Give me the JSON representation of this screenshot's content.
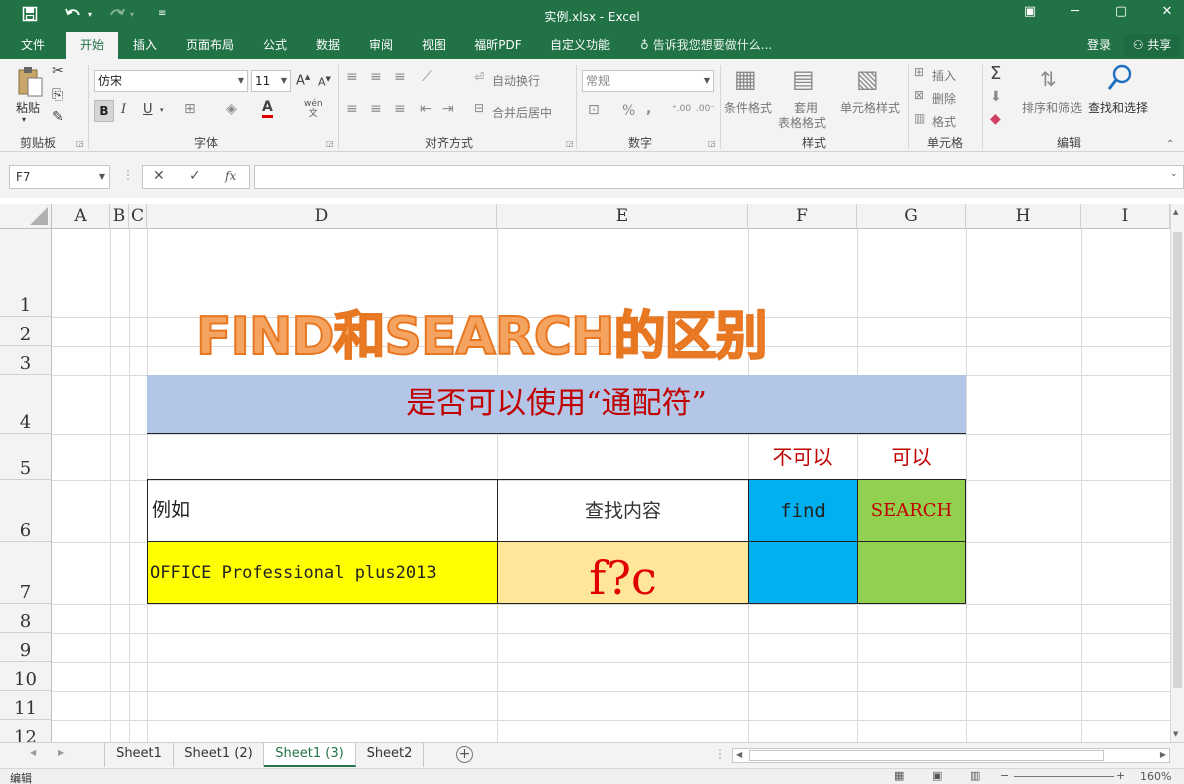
{
  "titlebar": {
    "title": "实例.xlsx - Excel",
    "save_icon": "save-icon",
    "undo_icon": "undo-icon",
    "redo_icon": "redo-icon",
    "customize_icon": "customize-quick-access-icon"
  },
  "tabs": {
    "items": [
      "文件",
      "开始",
      "插入",
      "页面布局",
      "公式",
      "数据",
      "审阅",
      "视图",
      "福昕PDF",
      "自定义功能"
    ],
    "active": "开始",
    "tell_me": "告诉我您想要做什么...",
    "sign_in": "登录",
    "share": "共享"
  },
  "ribbon": {
    "clipboard": {
      "paste": "粘贴",
      "label": "剪贴板"
    },
    "font": {
      "name": "仿宋",
      "size": "11",
      "bold": "B",
      "italic": "I",
      "underline": "U",
      "label": "字体",
      "phonetic": "wén"
    },
    "alignment": {
      "wrap": "自动换行",
      "merge": "合并后居中",
      "label": "对齐方式"
    },
    "number": {
      "format": "常规",
      "percent": "%",
      "comma": ",",
      "label": "数字"
    },
    "styles": {
      "conditional": "条件格式",
      "table": "套用",
      "table2": "表格格式",
      "cell_styles": "单元格样式",
      "label": "样式"
    },
    "cells": {
      "insert": "插入",
      "delete": "删除",
      "format": "格式",
      "label": "单元格"
    },
    "editing": {
      "sum": "Σ",
      "sort": "排序和筛选",
      "find": "查找和选择",
      "label": "编辑"
    }
  },
  "formula_bar": {
    "name_box": "F7",
    "cancel": "✕",
    "enter": "✓",
    "fx": "fx",
    "content": ""
  },
  "sheet": {
    "columns": [
      "A",
      "B",
      "C",
      "D",
      "E",
      "F",
      "G",
      "H",
      "I"
    ],
    "rows": [
      "1",
      "2",
      "3",
      "4",
      "5",
      "6",
      "7",
      "8",
      "9",
      "10",
      "11",
      "12"
    ],
    "title": "FIND和SEARCH的区别",
    "subtitle": "是否可以使用“通配符”",
    "f5": "不可以",
    "g5": "可以",
    "d6": "例如",
    "e6": "查找内容",
    "f6": "find",
    "g6": "SEARCH",
    "d7": "OFFICE Professional plus2013",
    "e7": "f?c"
  },
  "sheet_tabs": {
    "items": [
      "Sheet1",
      "Sheet1 (2)",
      "Sheet1 (3)",
      "Sheet2"
    ],
    "active": "Sheet1 (3)"
  },
  "status": {
    "mode": "编辑",
    "zoom": "160%"
  },
  "colors": {
    "excel_green": "#217346",
    "title_orange": "#f4a460",
    "band_blue": "#b4c6e7",
    "cell_yellow": "#ffff00",
    "cell_tan": "#ffe699",
    "cell_cyan": "#00b0f0",
    "cell_green": "#92d050",
    "text_red": "#c00000"
  }
}
